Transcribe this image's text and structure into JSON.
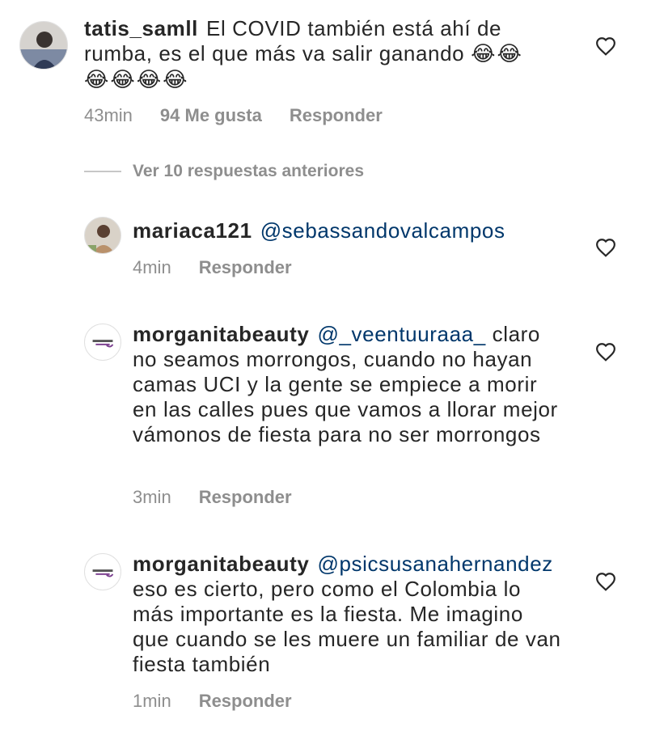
{
  "comments": [
    {
      "username": "tatis_samll",
      "text": "El  COVID también está ahí de rumba, es el que más va salir ganando",
      "emoji_inline": "😂😂",
      "emoji_line2": "😂😂😂😂",
      "time": "43min",
      "likes": "94 Me gusta",
      "reply": "Responder",
      "avatar_icon": "user-photo"
    }
  ],
  "view_more": "Ver 10 respuestas anteriores",
  "replies": [
    {
      "username": "mariaca121",
      "mention": "@sebassandovalcampos",
      "text": "",
      "time": "4min",
      "reply": "Responder"
    },
    {
      "username": "morganitabeauty",
      "mention": "@_veentuuraaa_",
      "text": "claro no seamos morrongos, cuando no hayan camas UCI y la gente se empiece a morir en las calles pues que vamos a llorar mejor vámonos de fiesta para no ser morrongos",
      "time": "3min",
      "reply": "Responder"
    },
    {
      "username": "morganitabeauty",
      "mention": "@psicsusanahernandez",
      "text": "eso es cierto, pero como el Colombia lo más importante es la fiesta. Me imagino que cuando se les muere un familiar de van fiesta también",
      "time": "1min",
      "reply": "Responder"
    }
  ],
  "colors": {
    "text": "#262626",
    "secondary": "#8e8e8e",
    "mention": "#00376b",
    "logo_accent": "#7b3f8f"
  }
}
